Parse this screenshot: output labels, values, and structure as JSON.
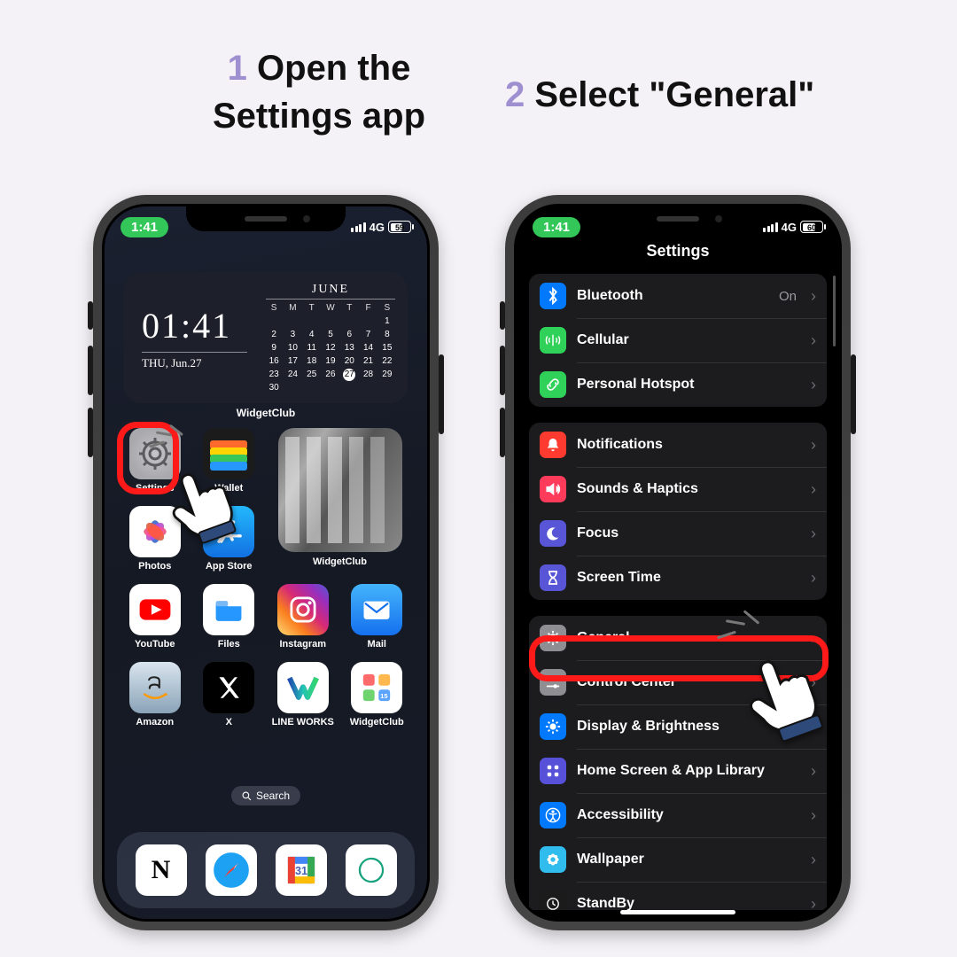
{
  "headings": {
    "step1_num": "1",
    "step1_text": "Open the Settings app",
    "step2_num": "2",
    "step2_text": "Select \"General\""
  },
  "status": {
    "time": "1:41",
    "net": "4G",
    "battery1": "59",
    "battery2": "60"
  },
  "widget": {
    "time": "01:41",
    "date": "THU, Jun.27",
    "month": "JUNE",
    "dow": [
      "S",
      "M",
      "T",
      "W",
      "T",
      "F",
      "S"
    ],
    "label": "WidgetClub",
    "photo_label": "WidgetClub"
  },
  "apps": {
    "settings": "Settings",
    "wallet": "Wallet",
    "photos": "Photos",
    "appstore": "App Store",
    "youtube": "YouTube",
    "files": "Files",
    "instagram": "Instagram",
    "mail": "Mail",
    "amazon": "Amazon",
    "x": "X",
    "lineworks": "LINE WORKS",
    "widgetclub": "WidgetClub"
  },
  "search": "Search",
  "settings_screen": {
    "title": "Settings",
    "bluetooth": "Bluetooth",
    "bluetooth_val": "On",
    "cellular": "Cellular",
    "hotspot": "Personal Hotspot",
    "notifications": "Notifications",
    "sounds": "Sounds & Haptics",
    "focus": "Focus",
    "screentime": "Screen Time",
    "general": "General",
    "controlcenter": "Control Center",
    "display": "Display & Brightness",
    "homescreen": "Home Screen & App Library",
    "accessibility": "Accessibility",
    "wallpaper": "Wallpaper",
    "standby": "StandBy"
  }
}
